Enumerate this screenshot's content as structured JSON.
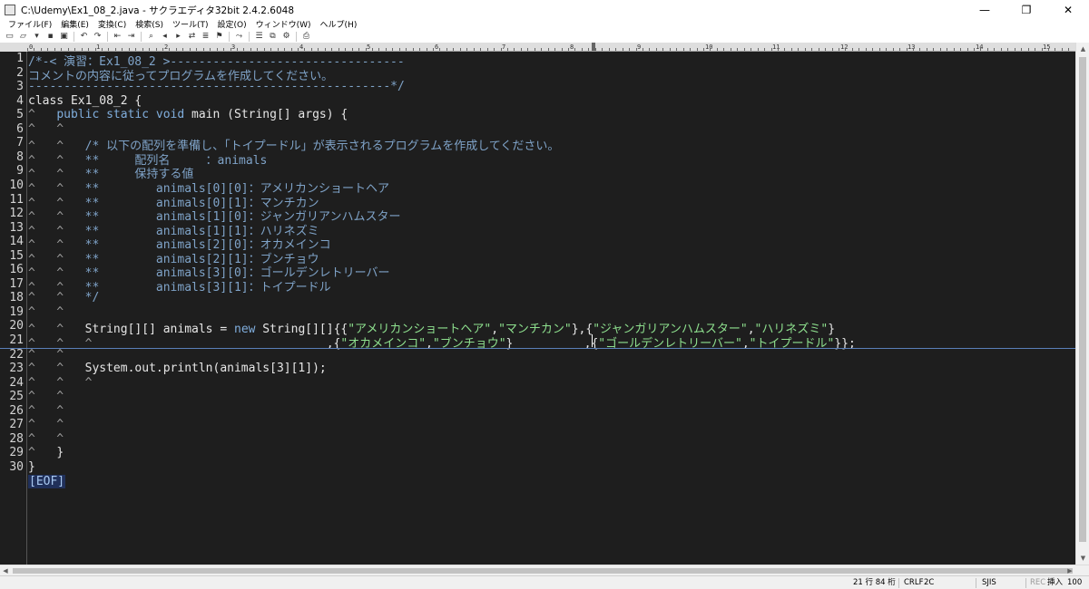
{
  "window": {
    "title": "C:\\Udemy\\Ex1_08_2.java - サクラエディタ32bit 2.4.2.6048",
    "minimize": "—",
    "maximize": "❐",
    "close": "✕"
  },
  "menu": [
    "ファイル(F)",
    "編集(E)",
    "変換(C)",
    "検索(S)",
    "ツール(T)",
    "設定(O)",
    "ウィンドウ(W)",
    "ヘルプ(H)"
  ],
  "toolbar": {
    "icons": [
      "new-file-icon",
      "open-file-icon",
      "dropdown-icon",
      "save-icon",
      "save-all-icon",
      "undo-icon",
      "redo-icon",
      "jump-back-icon",
      "jump-forward-icon",
      "find-icon",
      "find-prev-icon",
      "find-next-icon",
      "replace-icon",
      "grep-icon",
      "bookmark-icon",
      "tag-jump-icon",
      "outline-icon",
      "compare-icon",
      "macro-icon",
      "print-icon"
    ]
  },
  "ruler": {
    "numbers": [
      "0",
      "1",
      "2",
      "3",
      "4",
      "5",
      "6",
      "7",
      "8",
      "9",
      "10",
      "11",
      "12",
      "13",
      "14",
      "15"
    ]
  },
  "editor": {
    "lines": [
      {
        "n": "1",
        "parts": [
          {
            "t": "/*-< 演習：Ex1_08_2 >---------------------------------",
            "c": "comment"
          }
        ]
      },
      {
        "n": "2",
        "parts": [
          {
            "t": "コメントの内容に従ってプログラムを作成してください。",
            "c": "comment"
          }
        ]
      },
      {
        "n": "3",
        "parts": [
          {
            "t": "---------------------------------------------------*/",
            "c": "comment"
          }
        ]
      },
      {
        "n": "4",
        "parts": [
          {
            "t": "class Ex1_08_2 {",
            "c": "plain"
          }
        ]
      },
      {
        "n": "5",
        "parts": [
          {
            "t": "^   ",
            "c": "tab"
          },
          {
            "t": "public static void",
            "c": "kw"
          },
          {
            "t": " main (String[] args) {",
            "c": "plain"
          }
        ]
      },
      {
        "n": "6",
        "parts": [
          {
            "t": "^   ^",
            "c": "tab"
          }
        ]
      },
      {
        "n": "7",
        "parts": [
          {
            "t": "^   ^   ",
            "c": "tab"
          },
          {
            "t": "/* 以下の配列を準備し、「トイプードル」が表示されるプログラムを作成してください。",
            "c": "comment"
          }
        ]
      },
      {
        "n": "8",
        "parts": [
          {
            "t": "^   ^   ",
            "c": "tab"
          },
          {
            "t": "**     配列名     ：animals",
            "c": "comment"
          }
        ]
      },
      {
        "n": "9",
        "parts": [
          {
            "t": "^   ^   ",
            "c": "tab"
          },
          {
            "t": "**     保持する値",
            "c": "comment"
          }
        ]
      },
      {
        "n": "10",
        "parts": [
          {
            "t": "^   ^   ",
            "c": "tab"
          },
          {
            "t": "**        animals[0][0]：アメリカンショートヘア",
            "c": "comment"
          }
        ]
      },
      {
        "n": "11",
        "parts": [
          {
            "t": "^   ^   ",
            "c": "tab"
          },
          {
            "t": "**        animals[0][1]：マンチカン",
            "c": "comment"
          }
        ]
      },
      {
        "n": "12",
        "parts": [
          {
            "t": "^   ^   ",
            "c": "tab"
          },
          {
            "t": "**        animals[1][0]：ジャンガリアンハムスター",
            "c": "comment"
          }
        ]
      },
      {
        "n": "13",
        "parts": [
          {
            "t": "^   ^   ",
            "c": "tab"
          },
          {
            "t": "**        animals[1][1]：ハリネズミ",
            "c": "comment"
          }
        ]
      },
      {
        "n": "14",
        "parts": [
          {
            "t": "^   ^   ",
            "c": "tab"
          },
          {
            "t": "**        animals[2][0]：オカメインコ",
            "c": "comment"
          }
        ]
      },
      {
        "n": "15",
        "parts": [
          {
            "t": "^   ^   ",
            "c": "tab"
          },
          {
            "t": "**        animals[2][1]：ブンチョウ",
            "c": "comment"
          }
        ]
      },
      {
        "n": "16",
        "parts": [
          {
            "t": "^   ^   ",
            "c": "tab"
          },
          {
            "t": "**        animals[3][0]：ゴールデンレトリーバー",
            "c": "comment"
          }
        ]
      },
      {
        "n": "17",
        "parts": [
          {
            "t": "^   ^   ",
            "c": "tab"
          },
          {
            "t": "**        animals[3][1]：トイプードル",
            "c": "comment"
          }
        ]
      },
      {
        "n": "18",
        "parts": [
          {
            "t": "^   ^   ",
            "c": "tab"
          },
          {
            "t": "*/",
            "c": "comment"
          }
        ]
      },
      {
        "n": "19",
        "parts": [
          {
            "t": "^   ^",
            "c": "tab"
          }
        ]
      },
      {
        "n": "20",
        "parts": [
          {
            "t": "^   ^   ",
            "c": "tab"
          },
          {
            "t": "String[][] animals = ",
            "c": "plain"
          },
          {
            "t": "new",
            "c": "kw"
          },
          {
            "t": " String[][]{{",
            "c": "plain"
          },
          {
            "t": "\"アメリカンショートヘア\"",
            "c": "str"
          },
          {
            "t": ",",
            "c": "plain"
          },
          {
            "t": "\"マンチカン\"",
            "c": "str"
          },
          {
            "t": "},{",
            "c": "plain"
          },
          {
            "t": "\"ジャンガリアンハムスター\"",
            "c": "str"
          },
          {
            "t": ",",
            "c": "plain"
          },
          {
            "t": "\"ハリネズミ\"",
            "c": "str"
          },
          {
            "t": "}",
            "c": "plain"
          }
        ]
      },
      {
        "n": "21",
        "parts": [
          {
            "t": "^   ^   ^",
            "c": "tab"
          },
          {
            "t": "                                 ,{",
            "c": "plain"
          },
          {
            "t": "\"オカメインコ\"",
            "c": "str"
          },
          {
            "t": ",",
            "c": "plain"
          },
          {
            "t": "\"ブンチョウ\"",
            "c": "str"
          },
          {
            "t": "}          ,{",
            "c": "plain"
          },
          {
            "t": "\"ゴールデンレトリーバー\"",
            "c": "str"
          },
          {
            "t": ",",
            "c": "plain"
          },
          {
            "t": "\"トイプードル\"",
            "c": "str"
          },
          {
            "t": "}};",
            "c": "plain"
          }
        ]
      },
      {
        "n": "22",
        "parts": [
          {
            "t": "^   ^",
            "c": "tab"
          }
        ]
      },
      {
        "n": "23",
        "parts": [
          {
            "t": "^   ^   ",
            "c": "tab"
          },
          {
            "t": "System.out.println(animals[3][1]);",
            "c": "plain"
          }
        ]
      },
      {
        "n": "24",
        "parts": [
          {
            "t": "^   ^   ^",
            "c": "tab"
          }
        ]
      },
      {
        "n": "25",
        "parts": [
          {
            "t": "^   ^",
            "c": "tab"
          }
        ]
      },
      {
        "n": "26",
        "parts": [
          {
            "t": "^   ^",
            "c": "tab"
          }
        ]
      },
      {
        "n": "27",
        "parts": [
          {
            "t": "^   ^",
            "c": "tab"
          }
        ]
      },
      {
        "n": "28",
        "parts": [
          {
            "t": "^   ^",
            "c": "tab"
          }
        ]
      },
      {
        "n": "29",
        "parts": [
          {
            "t": "^   ",
            "c": "tab"
          },
          {
            "t": "}",
            "c": "plain"
          }
        ]
      },
      {
        "n": "30",
        "parts": [
          {
            "t": "}",
            "c": "plain"
          }
        ]
      },
      {
        "n": "",
        "parts": [
          {
            "t": "[EOF]",
            "c": "eof"
          }
        ]
      }
    ]
  },
  "status": {
    "position": "21 行   84 桁",
    "line_ending": "CRLF",
    "char_code": "2C",
    "encoding": "SJIS",
    "rec": "REC",
    "mode": "挿入",
    "zoom": "100 %"
  },
  "colors": {
    "editor_bg": "#1e1e1e",
    "comment": "#7fa3c8",
    "keyword": "#80aedd",
    "string": "#8ee08e",
    "text": "#e6e6e6"
  }
}
